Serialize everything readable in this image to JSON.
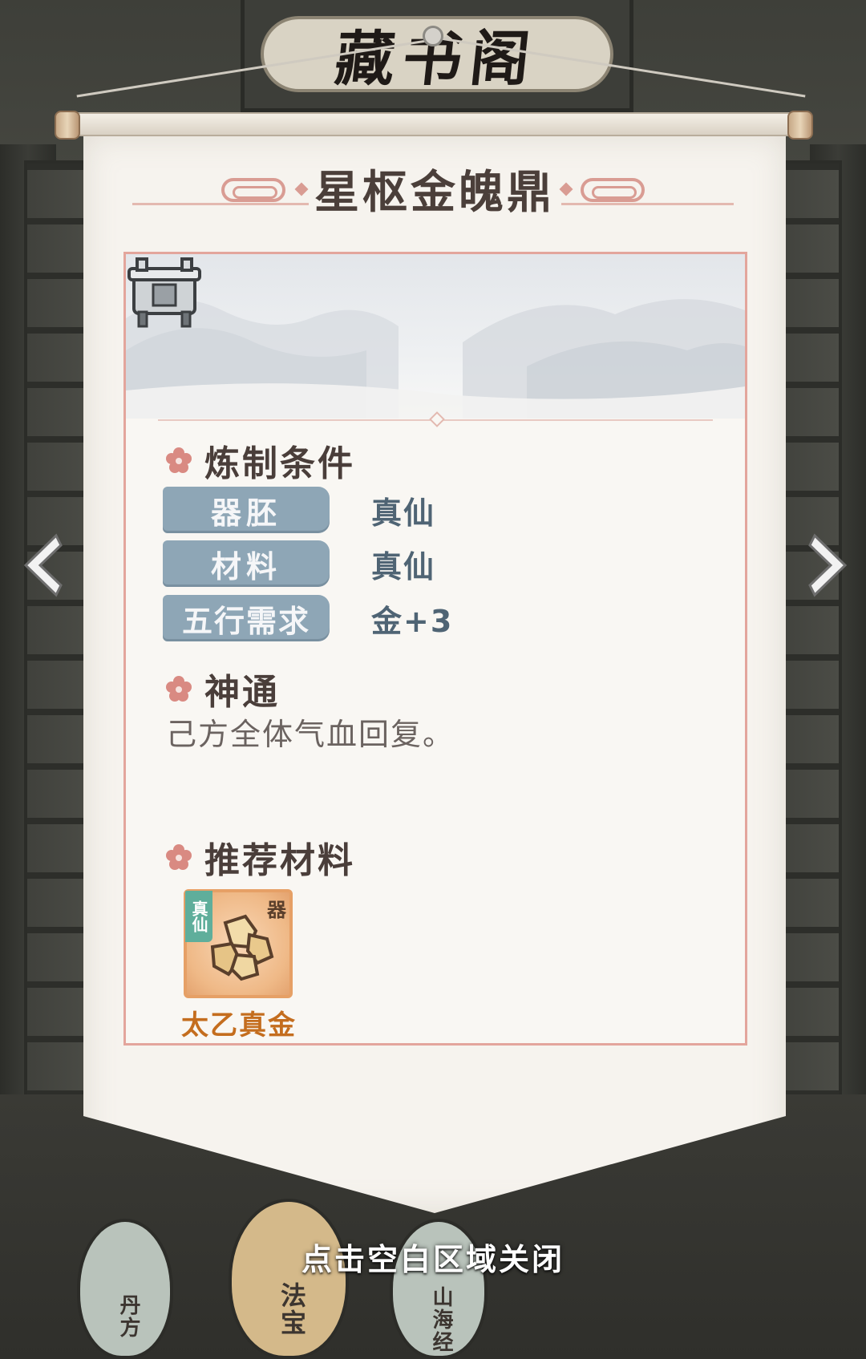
{
  "header": {
    "signboard_text": "藏书阁"
  },
  "scroll": {
    "title": "星枢金魄鼎",
    "sections": {
      "conditions": {
        "title": "炼制条件",
        "rows": [
          {
            "label": "器胚",
            "value": "真仙"
          },
          {
            "label": "材料",
            "value": "真仙"
          },
          {
            "label": "五行需求",
            "value": "金+3"
          }
        ]
      },
      "skill": {
        "title": "神通",
        "description": "己方全体气血回复。"
      },
      "materials": {
        "title": "推荐材料",
        "items": [
          {
            "name": "太乙真金",
            "rank": "真仙",
            "type": "器",
            "icon": "gold-ore-icon",
            "name_color": "#c46d1e"
          }
        ]
      }
    },
    "item_icon": "cauldron-icon"
  },
  "nav": {
    "prev_icon": "chevron-left-icon",
    "next_icon": "chevron-right-icon"
  },
  "characters": [
    {
      "label": "丹方"
    },
    {
      "label": "法宝"
    },
    {
      "label": "山海经"
    }
  ],
  "footer": {
    "close_hint": "点击空白区域关闭"
  },
  "colors": {
    "accent_pink": "#e3a59c",
    "label_blue": "#8ea6b6",
    "value_blue": "#4f6474",
    "material_orange": "#c46d1e",
    "rank_green": "#5fae9b"
  }
}
